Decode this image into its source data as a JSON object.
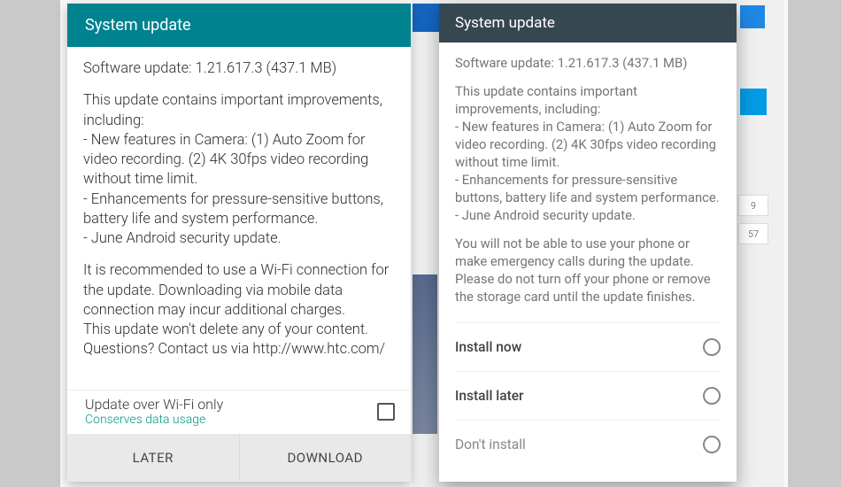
{
  "left": {
    "title": "System update",
    "line1": "Software update: 1.21.617.3 (437.1 MB)",
    "para2": "This update contains important improvements, including:\n- New features in Camera: (1) Auto Zoom for video recording. (2) 4K 30fps video recording without time limit.\n- Enhancements for pressure-sensitive buttons, battery life and system performance.\n- June Android security update.",
    "para3": "It is recommended to use a Wi-Fi connection for the update. Downloading via mobile data connection may incur additional charges.\nThis update won't delete any of your content. Questions? Contact us via http://www.htc.com/",
    "wifi_title": "Update over Wi-Fi only",
    "wifi_sub": "Conserves data usage",
    "btn_later": "LATER",
    "btn_download": "DOWNLOAD"
  },
  "right": {
    "title": "System update",
    "line1": "Software update: 1.21.617.3 (437.1 MB)",
    "para2": "This update contains important improvements, including:\n- New features in Camera: (1) Auto Zoom for video recording. (2) 4K 30fps video recording without time limit.\n- Enhancements for pressure-sensitive buttons, battery life and system performance.\n- June Android security update.",
    "para3": "You will not be able to use your phone or make emergency calls during the update. Please do not turn off your phone or remove the storage card until the update finishes.",
    "options": [
      {
        "label": "Install now"
      },
      {
        "label": "Install later"
      },
      {
        "label": "Don't install"
      }
    ]
  },
  "bg": {
    "badge1": "9",
    "badge2": "57"
  }
}
